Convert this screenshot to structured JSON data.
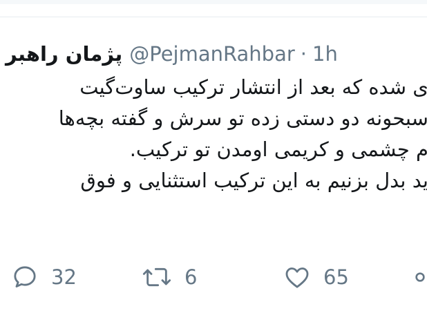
{
  "tweet": {
    "author_name": "پژمان راهبر",
    "handle": "@PejmanRahbar",
    "separator": "·",
    "timestamp": "1h",
    "lines": [
      "ی شده که بعد از انتشار ترکیب ساوت‌گیت",
      "سبحونه دو دستی زده تو سرش و گفته بچه‌ها",
      "م چشمی و کریمی اومدن تو ترکیب.",
      "ید بدل بزنیم به این ترکیب استثنایی و فوق"
    ]
  },
  "actions": {
    "reply": {
      "icon": "reply-icon",
      "count": "32"
    },
    "retweet": {
      "icon": "retweet-icon",
      "count": "6"
    },
    "like": {
      "icon": "heart-icon",
      "count": "65"
    },
    "more": {
      "icon": "more-icon"
    }
  },
  "colors": {
    "text": "#14171a",
    "secondary": "#657786",
    "border": "#e6ecf0"
  }
}
